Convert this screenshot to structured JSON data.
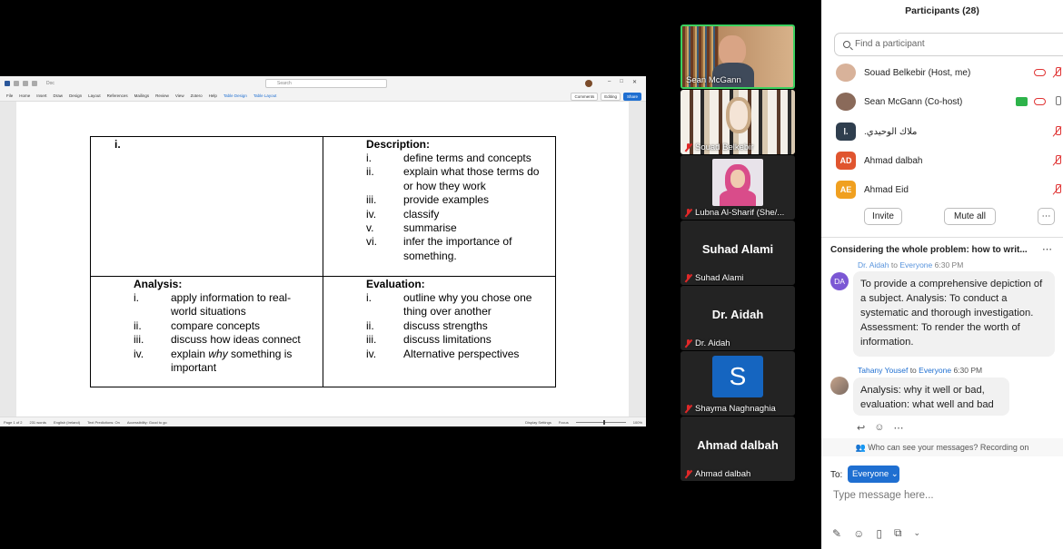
{
  "word": {
    "doc_name": "Doc",
    "search_placeholder": "Search",
    "ribbon_tabs": [
      "File",
      "Home",
      "Insert",
      "Draw",
      "Design",
      "Layout",
      "References",
      "Mailings",
      "Review",
      "View",
      "Zotero",
      "Help",
      "Table Design",
      "Table Layout"
    ],
    "comments_label": "Comments",
    "editing_label": "Editing",
    "share_label": "Share",
    "status": {
      "page": "Page 1 of 2",
      "words": "231 words",
      "language": "English (Ireland)",
      "predictions": "Text Predictions: On",
      "accessibility": "Accessibility: Good to go",
      "display": "Display Settings",
      "focus": "Focus",
      "zoom": "100%"
    },
    "table": {
      "c1_head": "i.",
      "description": {
        "head": "Description:",
        "items": [
          {
            "n": "i.",
            "t": "define terms and concepts"
          },
          {
            "n": "ii.",
            "t": "explain what those terms do or how they work"
          },
          {
            "n": "iii.",
            "t": "provide examples"
          },
          {
            "n": "iv.",
            "t": "classify"
          },
          {
            "n": "v.",
            "t": "summarise"
          },
          {
            "n": "vi.",
            "t": "infer the importance of something."
          }
        ]
      },
      "analysis": {
        "head": "Analysis:",
        "items": [
          {
            "n": "i.",
            "t": "apply information to real-world situations"
          },
          {
            "n": "ii.",
            "t": "compare concepts"
          },
          {
            "n": "iii.",
            "t": "discuss how ideas connect"
          },
          {
            "n": "iv.",
            "t_pre": "explain ",
            "t_em": "why",
            "t_post": " something is important"
          }
        ]
      },
      "evaluation": {
        "head": "Evaluation:",
        "items": [
          {
            "n": "i.",
            "t": "outline why you chose one thing over another"
          },
          {
            "n": "ii.",
            "t": "discuss strengths"
          },
          {
            "n": "iii.",
            "t": "discuss limitations"
          },
          {
            "n": "iv.",
            "t": "Alternative perspectives"
          }
        ]
      }
    }
  },
  "videos": [
    {
      "name": "Sean McGann",
      "muted": false
    },
    {
      "name": "Souad Belkebir",
      "muted": true
    },
    {
      "name": "Lubna Al-Sharif (She/...",
      "muted": true
    },
    {
      "name": "Suhad Alami",
      "big": "Suhad Alami",
      "muted": true
    },
    {
      "name": "Dr. Aidah",
      "big": "Dr. Aidah",
      "muted": true
    },
    {
      "name": "Shayma Naghnaghia",
      "avatar": "S",
      "muted": true
    },
    {
      "name": "Ahmad dalbah",
      "big": "Ahmad dalbah",
      "muted": true
    }
  ],
  "panel": {
    "title": "Participants (28)",
    "search_placeholder": "Find a participant",
    "participants": [
      {
        "name": "Souad Belkebir (Host, me)",
        "initials": "",
        "color": "#d8b29a"
      },
      {
        "name": "Sean McGann (Co-host)",
        "initials": "",
        "color": "#8a6a5a"
      },
      {
        "name": "ملاك الوحيدي.",
        "initials": "ا.",
        "color": "#2f3e4e"
      },
      {
        "name": "Ahmad dalbah",
        "initials": "AD",
        "color": "#e0552f"
      },
      {
        "name": "Ahmad Eid",
        "initials": "AE",
        "color": "#f0a020"
      }
    ],
    "invite_label": "Invite",
    "mute_all_label": "Mute all",
    "more_label": "⋯",
    "chat_title": "Considering the whole problem: how to writ...",
    "chat_more": "⋯",
    "messages": [
      {
        "sender": "Dr. Aidah",
        "to": "to",
        "recipient": "Everyone",
        "time": "6:30 PM",
        "initials": "DA",
        "text": "To provide a comprehensive depiction of a subject. Analysis: To conduct a systematic and thorough investigation. Assessment: To render the worth of information."
      },
      {
        "sender": "Tahany Yousef",
        "to": "to",
        "recipient": "Everyone",
        "time": "6:30 PM",
        "text": "Analysis: why it well or bad, evaluation: what well and bad"
      }
    ],
    "visibility_note": "Who can see your messages? Recording on",
    "to_label": "To:",
    "to_value": "Everyone",
    "input_placeholder": "Type message here..."
  }
}
